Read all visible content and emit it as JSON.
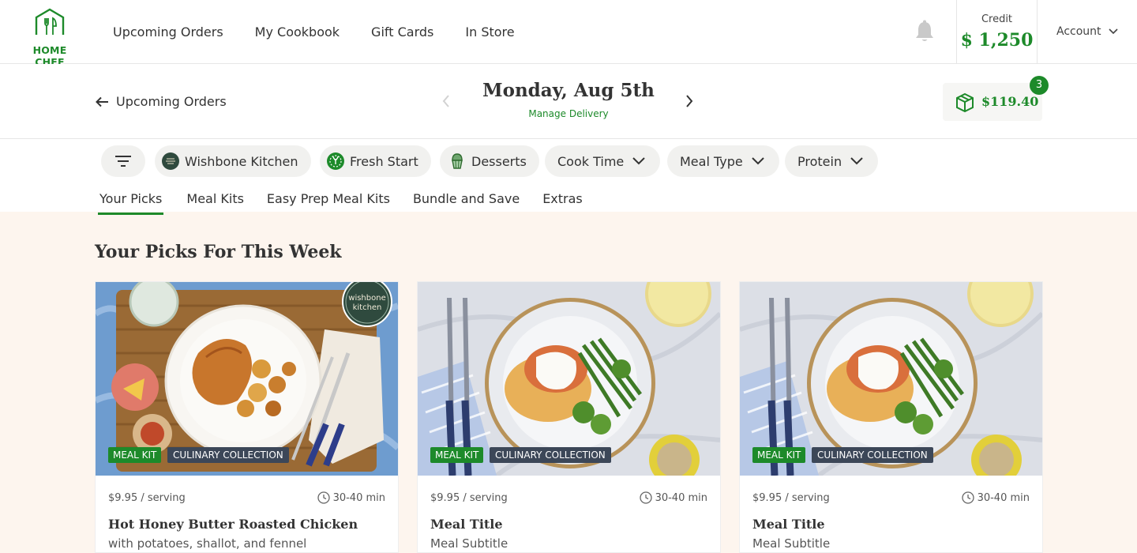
{
  "brand": {
    "logo_text": "HOME CHEF",
    "color": "#1d8a2a"
  },
  "nav": {
    "links": [
      "Upcoming Orders",
      "My Cookbook",
      "Gift Cards",
      "In Store"
    ],
    "bell_icon": "bell-icon",
    "credit_label": "Credit",
    "credit_value": "$ 1,250",
    "account_label": "Account"
  },
  "delivery": {
    "back_label": "Upcoming Orders",
    "date": "Monday, Aug 5th",
    "manage_label": "Manage Delivery",
    "cart_total": "$119.40",
    "cart_count": "3"
  },
  "filters": {
    "chips": [
      "Wishbone Kitchen",
      "Fresh Start",
      "Desserts",
      "Cook Time",
      "Meal Type",
      "Protein"
    ],
    "tabs": [
      "Your Picks",
      "Meal Kits",
      "Easy Prep Meal Kits",
      "Bundle and Save",
      "Extras"
    ],
    "active_tab": "Your Picks"
  },
  "main": {
    "section_title": "Your Picks For This Week",
    "cards": [
      {
        "badge1": "MEAL KIT",
        "badge2": "CULINARY COLLECTION",
        "price": "$9.95 / serving",
        "time": "30-40 min",
        "title": "Hot Honey Butter Roasted Chicken",
        "subtitle": "with potatoes, shallot, and fennel",
        "wishbone": "wishbone kitchen"
      },
      {
        "badge1": "MEAL KIT",
        "badge2": "CULINARY COLLECTION",
        "price": "$9.95 / serving",
        "time": "30-40 min",
        "title": "Meal Title",
        "subtitle": "Meal Subtitle"
      },
      {
        "badge1": "MEAL KIT",
        "badge2": "CULINARY COLLECTION",
        "price": "$9.95 / serving",
        "time": "30-40 min",
        "title": "Meal Title",
        "subtitle": "Meal Subtitle"
      }
    ]
  }
}
